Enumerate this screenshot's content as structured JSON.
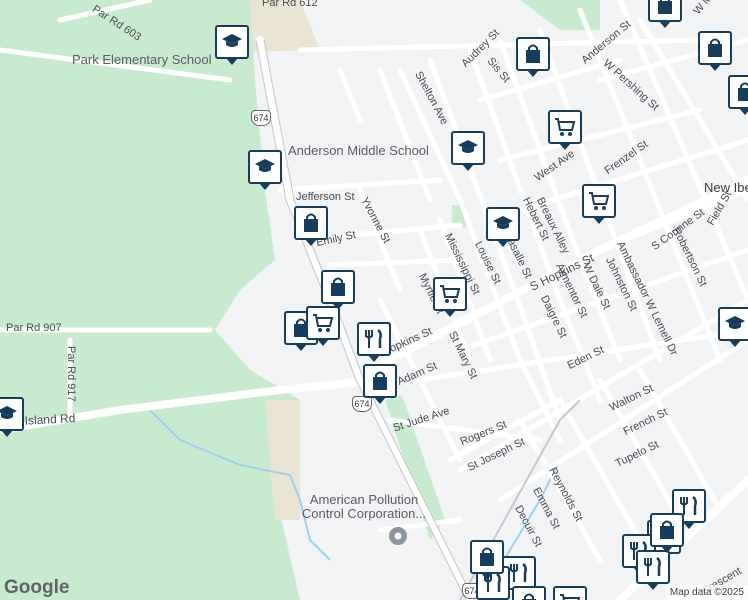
{
  "map": {
    "streets": [
      "Par Rd 612",
      "Par Rd 603",
      "Par Rd 907",
      "Par Rd 917",
      "son Island Rd",
      "Audrey St",
      "Sis St",
      "Anderson St",
      "W Pershing St",
      "Shelton Ave",
      "Frenzel St",
      "West Ave",
      "Jefferson St",
      "Yvonne St",
      "Emily St",
      "Breaux Alley",
      "Hebert St",
      "Louise St",
      "Mississippi St",
      "Myrtle St",
      "S Hopkins St",
      "Lasalle St",
      "Armentor St",
      "Daigre St",
      "W Dale St",
      "Johnston St",
      "Ambassador W Lemell Dr",
      "S Corinne St",
      "Field St",
      "Robertson St",
      "St Mary St",
      "Eden St",
      "Walton St",
      "French St",
      "Tupelo St",
      "St Jude Ave",
      "Rogers St",
      "St Joseph St",
      "Reynolds St",
      "Emma St",
      "Decuir St",
      "Adam St",
      "Hopkins St",
      "W Main St",
      "Crescent"
    ],
    "route_shields": [
      "674",
      "674",
      "674"
    ],
    "places": {
      "park_elementary": "Park Elementary School",
      "anderson_middle": "Anderson Middle School",
      "new_iberia": "New Iberia",
      "american_pollution": "American Pollution Control Corporation..."
    },
    "attribution": "Map data ©2025",
    "logo": "Google"
  },
  "markers": [
    {
      "type": "school-icon"
    },
    {
      "type": "school-icon"
    },
    {
      "type": "school-icon"
    },
    {
      "type": "school-icon"
    },
    {
      "type": "school-icon"
    },
    {
      "type": "school-icon"
    },
    {
      "type": "shopping-bag-icon"
    },
    {
      "type": "shopping-bag-icon"
    },
    {
      "type": "shopping-bag-icon"
    },
    {
      "type": "shopping-bag-icon"
    },
    {
      "type": "shopping-bag-icon"
    },
    {
      "type": "shopping-bag-icon"
    },
    {
      "type": "shopping-cart-icon"
    },
    {
      "type": "shopping-cart-icon"
    },
    {
      "type": "shopping-cart-icon"
    },
    {
      "type": "shopping-cart-icon"
    },
    {
      "type": "restaurant-icon"
    },
    {
      "type": "restaurant-icon"
    }
  ],
  "colors": {
    "marker": "#163d5c",
    "park": "#c8ebd0",
    "road": "#ffffff",
    "highway": "#bfc6cd",
    "water": "#9fd1f0"
  }
}
